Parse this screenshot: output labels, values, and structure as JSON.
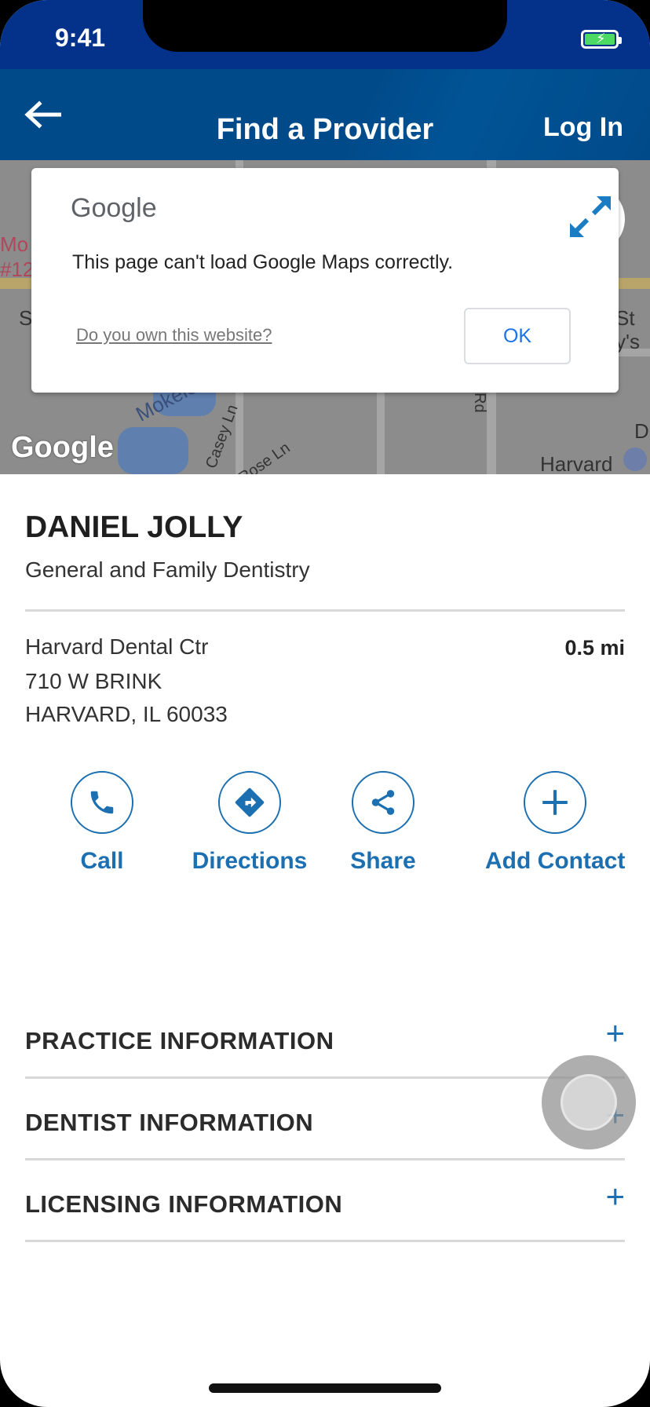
{
  "status_bar": {
    "time": "9:41"
  },
  "header": {
    "title": "Find a Provider",
    "login_label": "Log In"
  },
  "map": {
    "google_logo": "Google",
    "labels": [
      "Mo",
      "#12",
      "S",
      "St",
      "y's",
      "Mokeler Cree",
      "Casey Ln",
      "Rose Ln",
      "Rd",
      "Harvard",
      "D"
    ]
  },
  "maps_error_dialog": {
    "brand": "Google",
    "message": "This page can't load Google Maps correctly.",
    "link": "Do you own this website?",
    "ok_label": "OK"
  },
  "provider": {
    "name": "DANIEL JOLLY",
    "specialty": "General and Family Dentistry",
    "office_name": "Harvard Dental Ctr",
    "address_line1": "710 W BRINK",
    "address_line2": "HARVARD, IL 60033",
    "distance": "0.5 mi"
  },
  "actions": {
    "call": "Call",
    "directions": "Directions",
    "share": "Share",
    "add_contact": "Add Contact"
  },
  "sections": {
    "practice": "PRACTICE INFORMATION",
    "dentist": "DENTIST INFORMATION",
    "licensing": "LICENSING INFORMATION",
    "expand_symbol": "+"
  },
  "colors": {
    "header_blue": "#014a8a",
    "accent_blue": "#1c6fb0",
    "status_blue": "#04328a"
  }
}
